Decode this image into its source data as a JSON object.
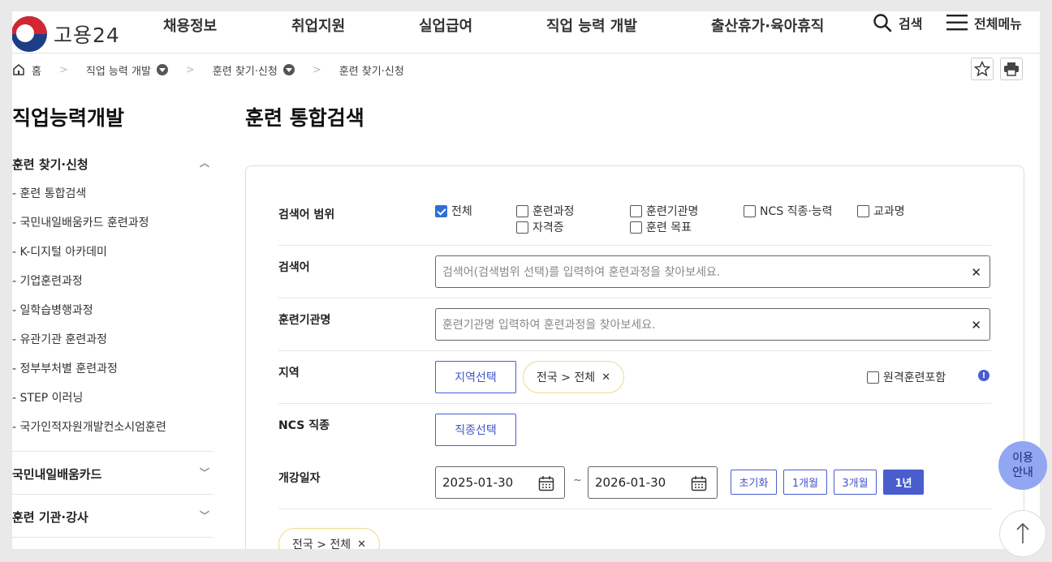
{
  "header": {
    "logo_text": "고용24",
    "nav": [
      "채용정보",
      "취업지원",
      "실업급여",
      "직업 능력 개발",
      "출산휴가·육아휴직"
    ],
    "search_label": "검색",
    "menu_label": "전체메뉴"
  },
  "breadcrumb": {
    "home": "홈",
    "level1": "직업 능력 개발",
    "level2": "훈련 찾기·신청",
    "level3": "훈련 찾기·신청"
  },
  "sidebar": {
    "title": "직업능력개발",
    "section1": "훈련 찾기·신청",
    "items": [
      "- 훈련 통합검색",
      "- 국민내일배움카드 훈련과정",
      "- K-디지털 아카데미",
      "- 기업훈련과정",
      "- 일학습병행과정",
      "- 유관기관 훈련과정",
      "- 정부부처별 훈련과정",
      "- STEP 이러닝",
      "- 국가인적자원개발컨소시엄훈련"
    ],
    "section2": "국민내일배움카드",
    "section3": "훈련 기관·강사"
  },
  "main": {
    "title": "훈련 통합검색",
    "scope_label": "검색어 범위",
    "scope_options": [
      {
        "label": "전체",
        "checked": true
      },
      {
        "label": "훈련과정",
        "checked": false
      },
      {
        "label": "훈련기관명",
        "checked": false
      },
      {
        "label": "NCS 직종·능력",
        "checked": false
      },
      {
        "label": "교과명",
        "checked": false
      },
      {
        "label": "자격증",
        "checked": false
      },
      {
        "label": "훈련 목표",
        "checked": false
      }
    ],
    "keyword_label": "검색어",
    "keyword_placeholder": "검색어(검색범위 선택)를 입력하여 훈련과정을 찾아보세요.",
    "institution_label": "훈련기관명",
    "institution_placeholder": "훈련기관명 입력하여 훈련과정을 찾아보세요.",
    "region_label": "지역",
    "region_button": "지역선택",
    "region_chip": "전국 > 전체",
    "remote_label": "원격훈련포함",
    "ncs_label": "NCS 직종",
    "ncs_button": "직종선택",
    "date_label": "개강일자",
    "date_start": "2025-01-30",
    "date_tilde": "~",
    "date_end": "2026-01-30",
    "date_buttons": [
      "초기화",
      "1개월",
      "3개월",
      "1년"
    ],
    "date_selected": "1년",
    "selected_chip": "전국 > 전체"
  },
  "float": {
    "guide_line1": "이용",
    "guide_line2": "안내"
  },
  "colors": {
    "accent": "#4a5dcf",
    "chip_border": "#eadb8c",
    "guide_bg": "#91a7f2"
  }
}
